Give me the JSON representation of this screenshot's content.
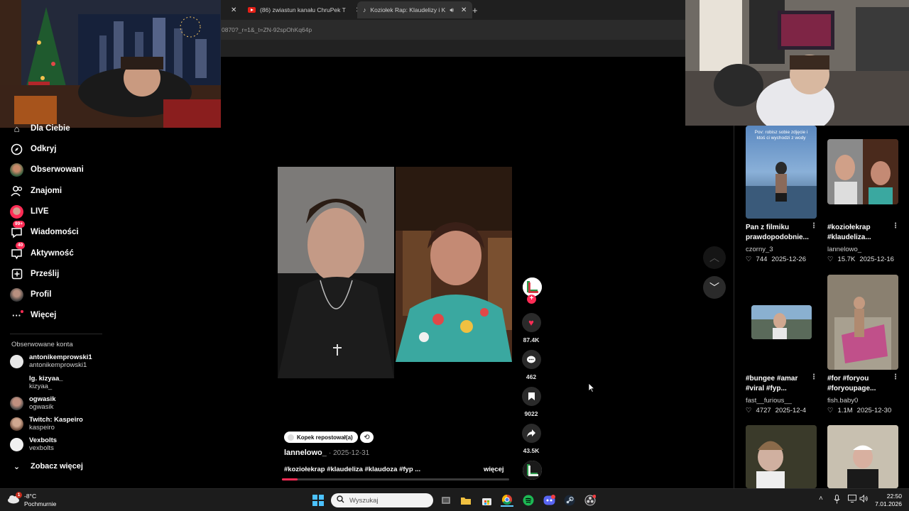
{
  "browser": {
    "tabs": [
      {
        "label": "(86) zwiastun kanału ChruPek T"
      },
      {
        "label": "Koziołek Rap: Klaudelizy i K"
      }
    ],
    "address": "0870?_r=1&_t=ZN-92spOhKq64p"
  },
  "sidebar": {
    "items": [
      {
        "label": "Dla Ciebie",
        "icon": "home-icon"
      },
      {
        "label": "Odkryj",
        "icon": "compass-icon"
      },
      {
        "label": "Obserwowani",
        "icon": "following-icon"
      },
      {
        "label": "Znajomi",
        "icon": "friends-icon"
      },
      {
        "label": "LIVE",
        "icon": "live-icon"
      },
      {
        "label": "Wiadomości",
        "icon": "messages-icon",
        "badge": "99+"
      },
      {
        "label": "Aktywność",
        "icon": "activity-icon",
        "badge": "40"
      },
      {
        "label": "Prześlij",
        "icon": "upload-icon"
      },
      {
        "label": "Profil",
        "icon": "profile-icon"
      },
      {
        "label": "Więcej",
        "icon": "more-icon"
      }
    ],
    "following_title": "Obserwowane konta",
    "following": [
      {
        "name": "antonikemprowski1",
        "username": "antonikemprowski1"
      },
      {
        "name": "Ig. kizyaa_",
        "username": "kizyaa_"
      },
      {
        "name": "ogwasik",
        "username": "ogwasik"
      },
      {
        "name": "Twitch: Kaspeiro",
        "username": "kaspeiro"
      },
      {
        "name": "Vexbolts",
        "username": "vexbolts"
      }
    ],
    "see_more": "Zobacz więcej"
  },
  "video": {
    "repost_label": "Kopek repostował(a)",
    "author": "lannelowo_",
    "date": "· 2025-12-31",
    "caption": "#koziołekrap #klaudeliza #klaudoza #fyp ...",
    "more": "więcej",
    "progress": 0.07,
    "likes": "87.4K",
    "comments": "462",
    "saves": "9022",
    "shares": "43.5K"
  },
  "recommendations": [
    {
      "title": "Pan z filmiku prawdopodobnie...",
      "author": "czorny_3",
      "likes": "744",
      "date": "2025-12-26",
      "overlay": "Pov: robisz sobie zdjęcie i ktoś ci wychodzi z wody"
    },
    {
      "title": "#koziołekrap #klaudeliza...",
      "author": "lannelowo_",
      "likes": "15.7K",
      "date": "2025-12-16"
    },
    {
      "title": "#bungee #amar #viral #fyp...",
      "author": "fast__furious__",
      "likes": "4727",
      "date": "2025-12-4"
    },
    {
      "title": "#for #foryou #foryoupage...",
      "author": "fish.baby0",
      "likes": "1.1M",
      "date": "2025-12-30"
    }
  ],
  "taskbar": {
    "temperature": "-8°C",
    "weather": "Pochmurnie",
    "weather_badge": "1",
    "search_placeholder": "Wyszukaj",
    "time": "22:50",
    "date": "7.01.2026"
  },
  "colors": {
    "accent": "#fe2c55",
    "background": "#000000",
    "taskbar": "#1c1c1c"
  }
}
